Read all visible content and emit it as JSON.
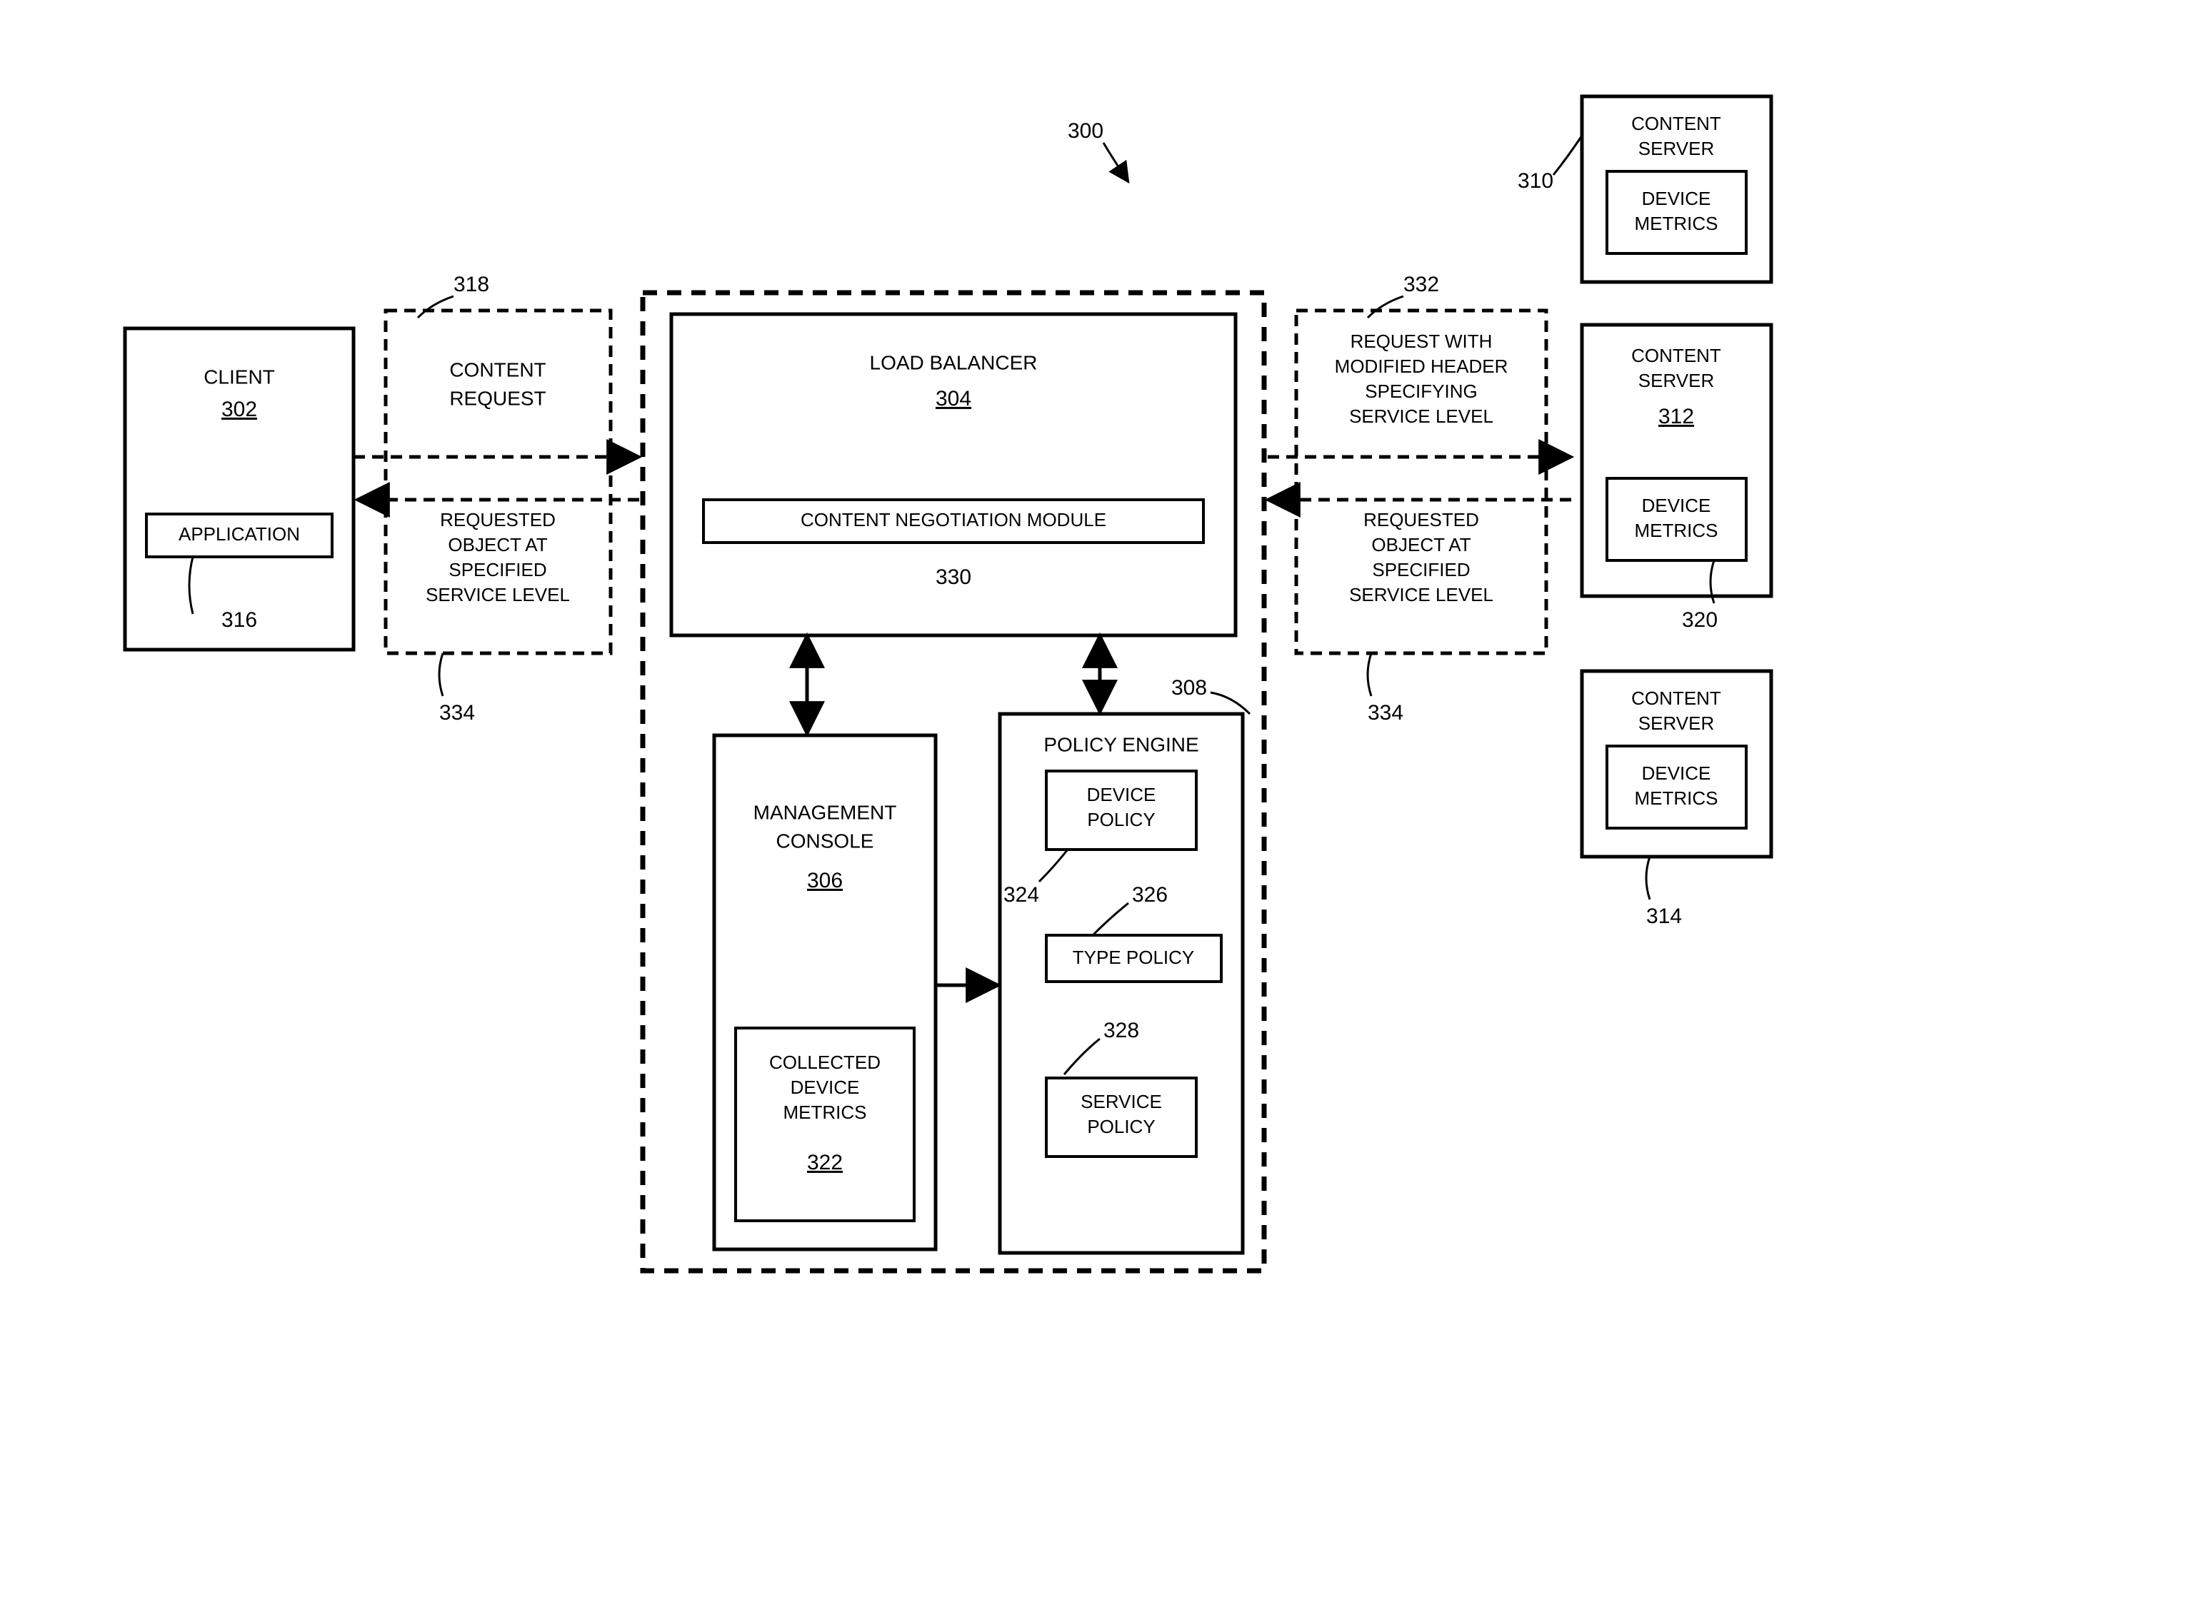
{
  "diagram_ref": "300",
  "client": {
    "title": "CLIENT",
    "ref": "302",
    "app_label": "APPLICATION",
    "app_ref": "316"
  },
  "content_request": {
    "label_l1": "CONTENT",
    "label_l2": "REQUEST",
    "ref": "318"
  },
  "requested_left": {
    "l1": "REQUESTED",
    "l2": "OBJECT AT",
    "l3": "SPECIFIED",
    "l4": "SERVICE LEVEL",
    "ref": "334"
  },
  "load_balancer": {
    "title": "LOAD BALANCER",
    "ref": "304",
    "cnm_label": "CONTENT NEGOTIATION MODULE",
    "cnm_ref": "330"
  },
  "mgmt_console": {
    "title_l1": "MANAGEMENT",
    "title_l2": "CONSOLE",
    "ref": "306",
    "collected_l1": "COLLECTED",
    "collected_l2": "DEVICE",
    "collected_l3": "METRICS",
    "collected_ref": "322"
  },
  "policy_engine": {
    "title": "POLICY ENGINE",
    "ref": "308",
    "device_l1": "DEVICE",
    "device_l2": "POLICY",
    "device_ref": "324",
    "type_label": "TYPE POLICY",
    "type_ref": "326",
    "service_l1": "SERVICE",
    "service_l2": "POLICY",
    "service_ref": "328"
  },
  "request_mod": {
    "l1": "REQUEST WITH",
    "l2": "MODIFIED HEADER",
    "l3": "SPECIFYING",
    "l4": "SERVICE LEVEL",
    "ref": "332"
  },
  "requested_right": {
    "l1": "REQUESTED",
    "l2": "OBJECT AT",
    "l3": "SPECIFIED",
    "l4": "SERVICE LEVEL",
    "ref": "334"
  },
  "servers": {
    "s1": {
      "title_l1": "CONTENT",
      "title_l2": "SERVER",
      "metrics_l1": "DEVICE",
      "metrics_l2": "METRICS",
      "ref": "310"
    },
    "s2": {
      "title_l1": "CONTENT",
      "title_l2": "SERVER",
      "metrics_l1": "DEVICE",
      "metrics_l2": "METRICS",
      "ref": "312",
      "metrics_ref": "320"
    },
    "s3": {
      "title_l1": "CONTENT",
      "title_l2": "SERVER",
      "metrics_l1": "DEVICE",
      "metrics_l2": "METRICS",
      "ref": "314"
    }
  }
}
